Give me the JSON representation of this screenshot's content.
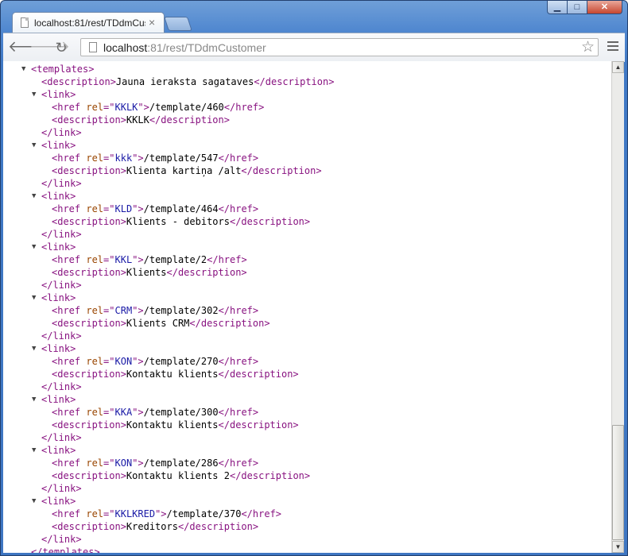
{
  "browser": {
    "tab_title": "localhost:81/rest/TDdmCustomer",
    "tab_close": "×",
    "url_host": "localhost",
    "url_path": ":81/rest/TDdmCustomer"
  },
  "xml": {
    "root_tag": "templates",
    "description": "Jauna ieraksta sagataves",
    "links": [
      {
        "rel": "KKLK",
        "href": "/template/460",
        "description": "KKLK"
      },
      {
        "rel": "kkk",
        "href": "/template/547",
        "description": "Klienta kartiņa /alt"
      },
      {
        "rel": "KLD",
        "href": "/template/464",
        "description": "Klients - debitors"
      },
      {
        "rel": "KKL",
        "href": "/template/2",
        "description": "Klients"
      },
      {
        "rel": "CRM",
        "href": "/template/302",
        "description": "Klients CRM"
      },
      {
        "rel": "KON",
        "href": "/template/270",
        "description": "Kontaktu klients"
      },
      {
        "rel": "KKA",
        "href": "/template/300",
        "description": "Kontaktu klients"
      },
      {
        "rel": "KON",
        "href": "/template/286",
        "description": "Kontaktu klients 2"
      },
      {
        "rel": "KKLKRED",
        "href": "/template/370",
        "description": "Kreditors"
      }
    ]
  },
  "colors": {
    "tag": "#881280",
    "attr_name": "#994500",
    "attr_value": "#1a1aa6"
  }
}
